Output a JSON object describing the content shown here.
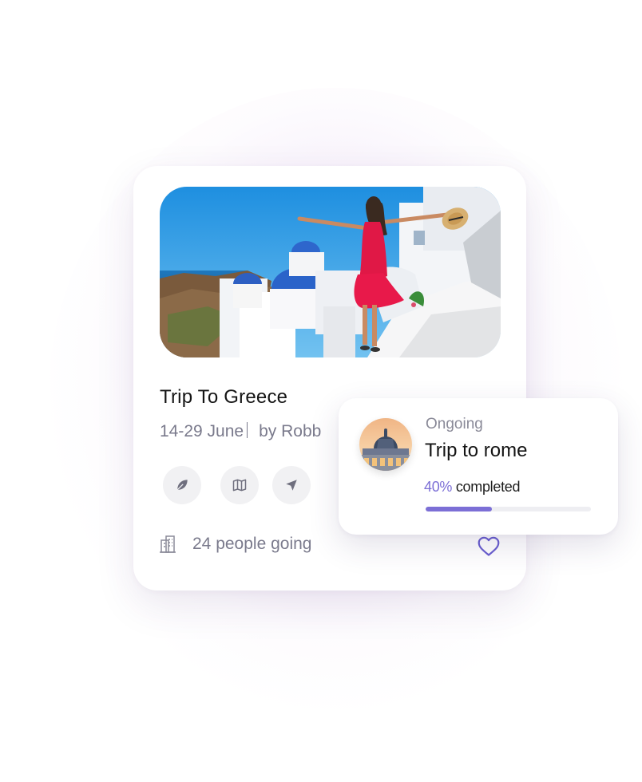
{
  "colors": {
    "accent": "#7c6fd6",
    "muted_text": "#7a7a8c",
    "icon_bg": "#f1f1f3",
    "heart": "#6a5fd0"
  },
  "card": {
    "title": "Trip To Greece",
    "dates": "14-29 June",
    "byline": "by Robb",
    "image_icon": "santorini-photo",
    "actions": [
      {
        "icon": "leaf-icon"
      },
      {
        "icon": "map-icon"
      },
      {
        "icon": "send-icon"
      }
    ],
    "people_icon": "building-icon",
    "people_label": "24 people going",
    "favorite_icon": "heart-icon"
  },
  "overlay": {
    "status": "Ongoing",
    "title": "Trip to rome",
    "avatar_icon": "st-peters-dome-photo",
    "progress_percent": "40%",
    "progress_suffix": " completed",
    "progress": 0.4
  }
}
